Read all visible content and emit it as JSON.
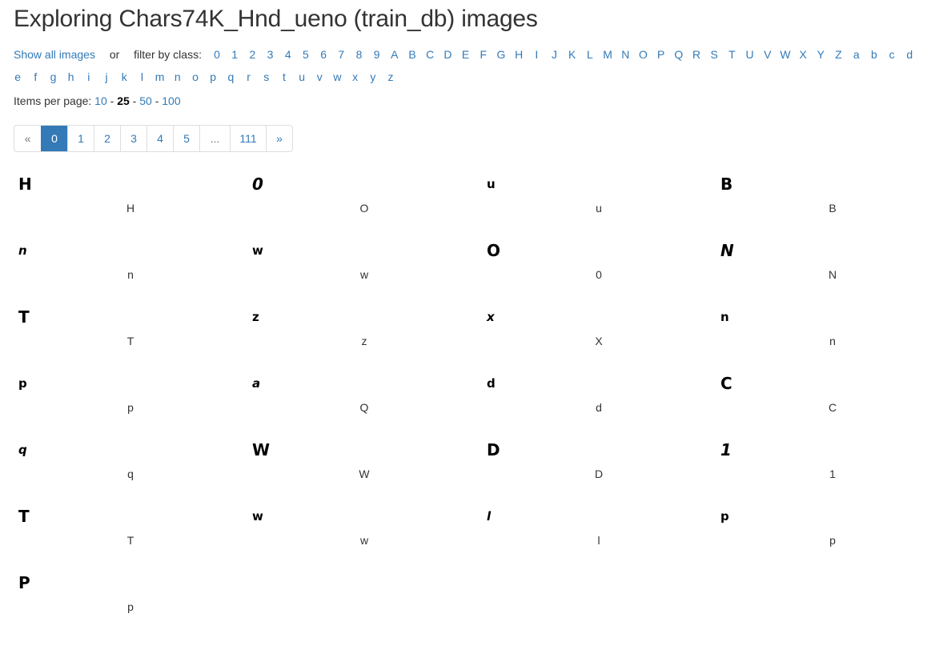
{
  "page": {
    "title": "Exploring Chars74K_Hnd_ueno (train_db) images"
  },
  "filter": {
    "show_all_label": "Show all images",
    "or_text": "or",
    "filter_by_text": "filter by class:",
    "classes_row1": [
      "0",
      "1",
      "2",
      "3",
      "4",
      "5",
      "6",
      "7",
      "8",
      "9",
      "A",
      "B",
      "C",
      "D",
      "E",
      "F",
      "G",
      "H",
      "I",
      "J",
      "K",
      "L",
      "M",
      "N",
      "O",
      "P",
      "Q",
      "R",
      "S",
      "T",
      "U",
      "V",
      "W",
      "X",
      "Y",
      "Z",
      "a",
      "b",
      "c",
      "d"
    ],
    "classes_row2": [
      "e",
      "f",
      "g",
      "h",
      "i",
      "j",
      "k",
      "l",
      "m",
      "n",
      "o",
      "p",
      "q",
      "r",
      "s",
      "t",
      "u",
      "v",
      "w",
      "x",
      "y",
      "z"
    ]
  },
  "items_per_page": {
    "label": "Items per page:",
    "options": [
      "10",
      "25",
      "50",
      "100"
    ],
    "selected": "25",
    "separator": "-"
  },
  "pagination": {
    "prev": "«",
    "pages": [
      "0",
      "1",
      "2",
      "3",
      "4",
      "5"
    ],
    "ellipsis": "...",
    "last": "111",
    "next": "»",
    "active": "0"
  },
  "images": [
    {
      "glyph": "H",
      "label": "H"
    },
    {
      "glyph": "0",
      "label": "O"
    },
    {
      "glyph": "u",
      "label": "u"
    },
    {
      "glyph": "B",
      "label": "B"
    },
    {
      "glyph": "n",
      "label": "n"
    },
    {
      "glyph": "w",
      "label": "w"
    },
    {
      "glyph": "O",
      "label": "0"
    },
    {
      "glyph": "N",
      "label": "N"
    },
    {
      "glyph": "T",
      "label": "T"
    },
    {
      "glyph": "z",
      "label": "z"
    },
    {
      "glyph": "x",
      "label": "X"
    },
    {
      "glyph": "n",
      "label": "n"
    },
    {
      "glyph": "p",
      "label": "p"
    },
    {
      "glyph": "a",
      "label": "Q"
    },
    {
      "glyph": "d",
      "label": "d"
    },
    {
      "glyph": "C",
      "label": "C"
    },
    {
      "glyph": "q",
      "label": "q"
    },
    {
      "glyph": "W",
      "label": "W"
    },
    {
      "glyph": "D",
      "label": "D"
    },
    {
      "glyph": "1",
      "label": "1"
    },
    {
      "glyph": "T",
      "label": "T"
    },
    {
      "glyph": "w",
      "label": "w"
    },
    {
      "glyph": "l",
      "label": "l"
    },
    {
      "glyph": "p",
      "label": "p"
    },
    {
      "glyph": "P",
      "label": "p"
    }
  ]
}
